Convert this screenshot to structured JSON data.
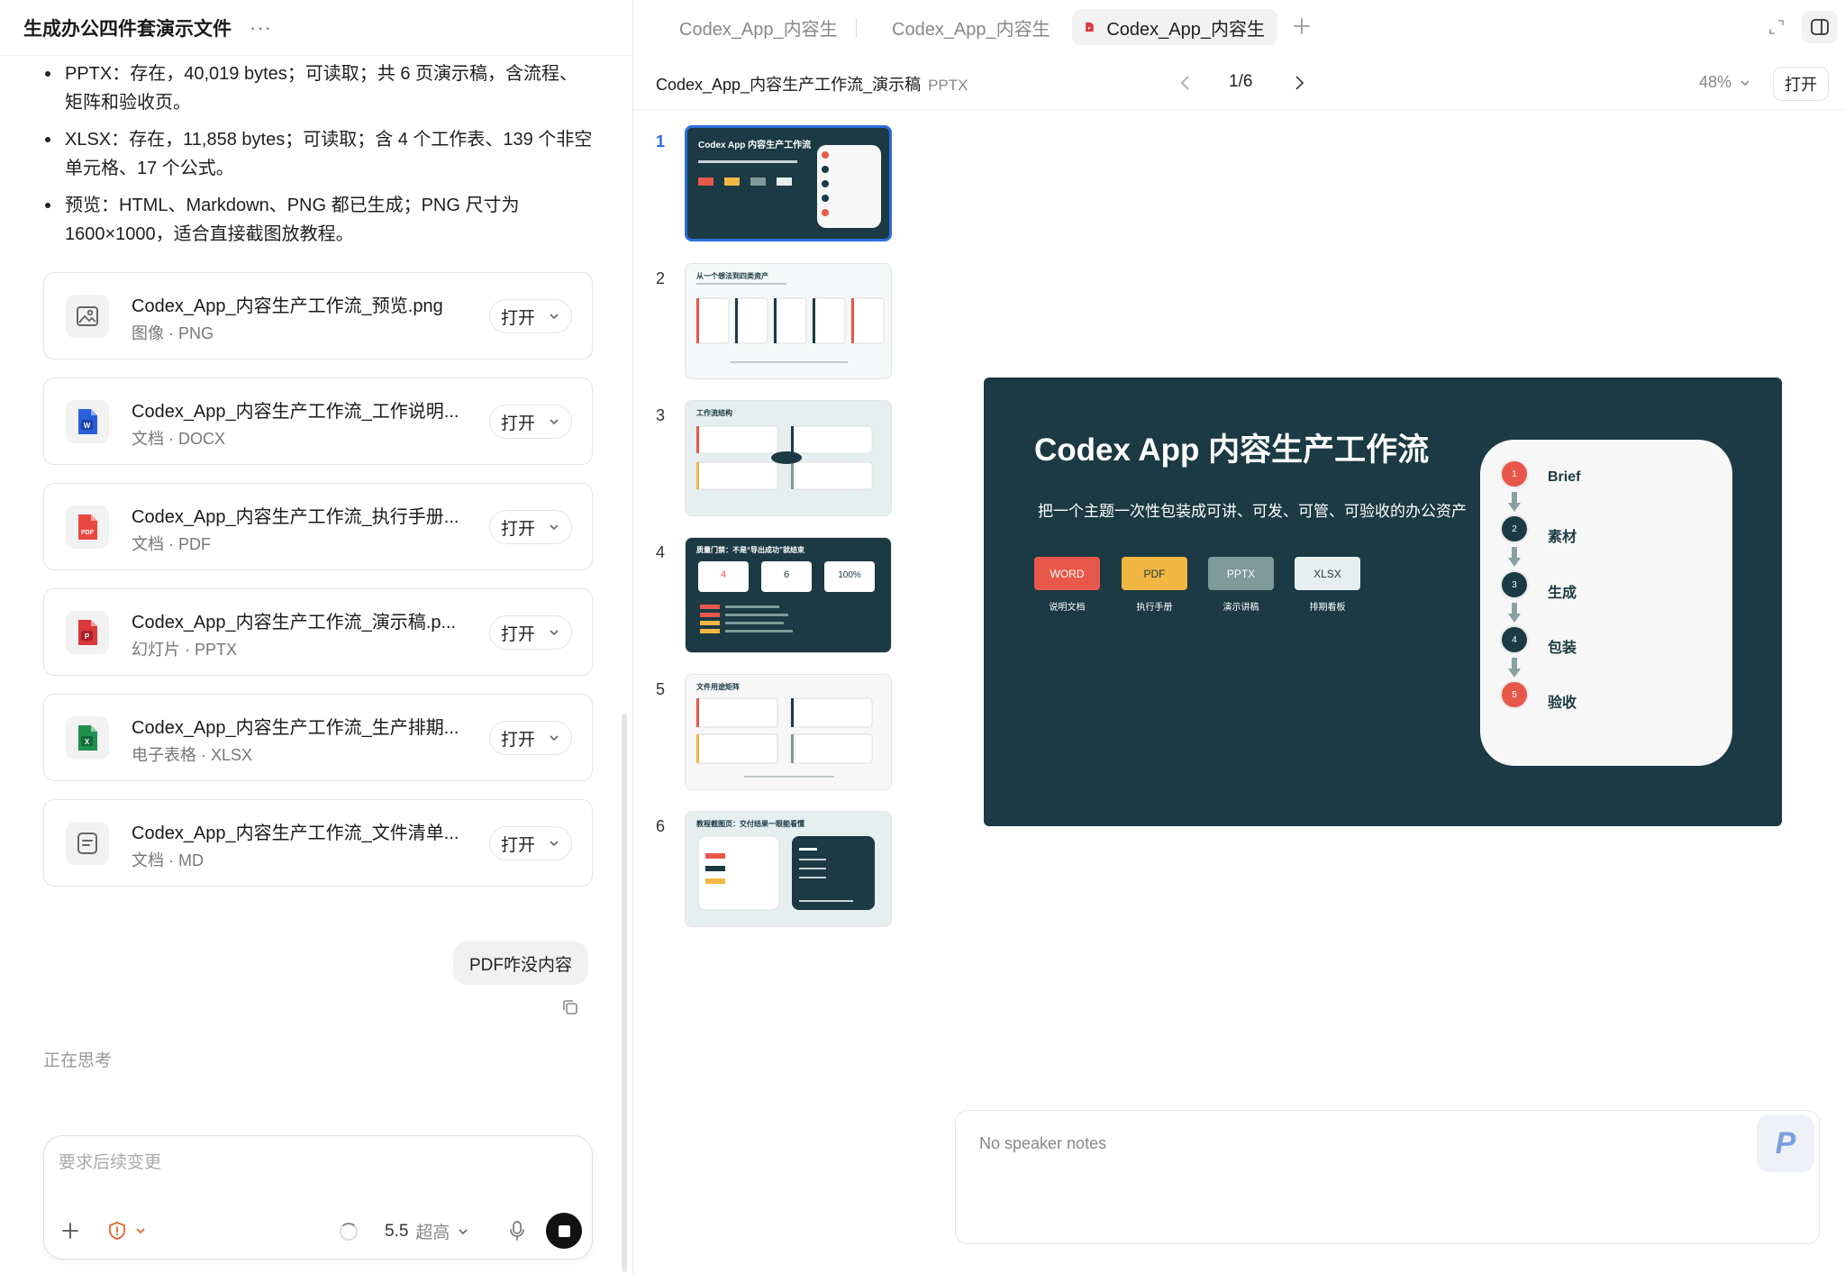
{
  "left": {
    "title": "生成办公四件套演示文件",
    "more": "···",
    "bullets": [
      "PPTX：存在，40,019 bytes；可读取；共 6 页演示稿，含流程、矩阵和验收页。",
      "XLSX：存在，11,858 bytes；可读取；含 4 个工作表、139 个非空单元格、17 个公式。",
      "预览：HTML、Markdown、PNG 都已生成；PNG 尺寸为 1600×1000，适合直接截图放教程。"
    ],
    "files": [
      {
        "name": "Codex_App_内容生产工作流_预览.png",
        "type": "图像 · PNG",
        "icon": "image-icon",
        "color": "#666666"
      },
      {
        "name": "Codex_App_内容生产工作流_工作说明...",
        "type": "文档 · DOCX",
        "icon": "word-icon",
        "color": "#2b5fd9"
      },
      {
        "name": "Codex_App_内容生产工作流_执行手册...",
        "type": "文档 · PDF",
        "icon": "pdf-icon",
        "color": "#e8483f"
      },
      {
        "name": "Codex_App_内容生产工作流_演示稿.p...",
        "type": "幻灯片 · PPTX",
        "icon": "powerpoint-icon",
        "color": "#d9393c"
      },
      {
        "name": "Codex_App_内容生产工作流_生产排期...",
        "type": "电子表格 · XLSX",
        "icon": "excel-icon",
        "color": "#1f8f4e"
      },
      {
        "name": "Codex_App_内容生产工作流_文件清单...",
        "type": "文档 · MD",
        "icon": "document-icon",
        "color": "#666666"
      }
    ],
    "open_label": "打开",
    "user_message": "PDF咋没内容",
    "thinking": "正在思考",
    "composer": {
      "placeholder": "要求后续变更",
      "model": "5.5",
      "quality": "超高"
    }
  },
  "right": {
    "tabs": [
      {
        "label": "Codex_App_内容生",
        "icon": "word-icon"
      },
      {
        "label": "Codex_App_内容生",
        "icon": "pdf-icon"
      },
      {
        "label": "Codex_App_内容生",
        "icon": "powerpoint-icon"
      }
    ],
    "doc_name": "Codex_App_内容生产工作流_演示稿",
    "doc_type": "PPTX",
    "page": "1/6",
    "zoom": "48%",
    "open_label": "打开",
    "thumb_numbers": [
      "1",
      "2",
      "3",
      "4",
      "5",
      "6"
    ],
    "thumbs": [
      {
        "title": "Codex App 内容生产工作流",
        "dark": true
      },
      {
        "title": "从一个想法到四类资产",
        "dark": false
      },
      {
        "title": "工作流结构",
        "dark": false
      },
      {
        "title": "质量门禁：不是“导出成功”就结束",
        "dark": true,
        "stats": [
          "4",
          "6",
          "100%"
        ]
      },
      {
        "title": "文件用途矩阵",
        "dark": false
      },
      {
        "title": "教程截图页：交付结果一眼能看懂",
        "dark": false
      }
    ],
    "slide": {
      "title": "Codex App 内容生产工作流",
      "subtitle": "把一个主题一次性包装成可讲、可发、可管、可验收的办公资产",
      "chips": [
        {
          "label": "WORD",
          "caption": "说明文档",
          "bg": "#e8584a",
          "fg": "#ffffff"
        },
        {
          "label": "PDF",
          "caption": "执行手册",
          "bg": "#f2b642",
          "fg": "#1b3a44"
        },
        {
          "label": "PPTX",
          "caption": "演示讲稿",
          "bg": "#7f9a9a",
          "fg": "#ffffff"
        },
        {
          "label": "XLSX",
          "caption": "排期看板",
          "bg": "#e7efee",
          "fg": "#1b3a44"
        }
      ],
      "steps": [
        {
          "num": "1",
          "label": "Brief",
          "color": "#e8584a"
        },
        {
          "num": "2",
          "label": "素材",
          "color": "#1b3a44"
        },
        {
          "num": "3",
          "label": "生成",
          "color": "#1b3a44"
        },
        {
          "num": "4",
          "label": "包装",
          "color": "#1b3a44"
        },
        {
          "num": "5",
          "label": "验收",
          "color": "#e8584a"
        }
      ]
    },
    "notes": "No speaker notes",
    "badge": "P"
  }
}
